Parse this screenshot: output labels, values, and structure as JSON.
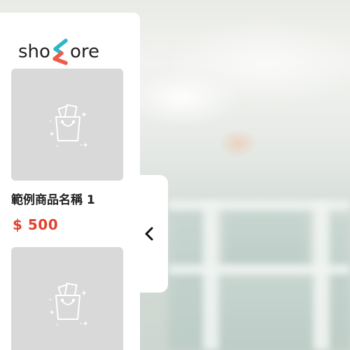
{
  "brand": {
    "logo_prefix": "sho",
    "logo_suffix": "ore",
    "logo_mark_colors": [
      "#2fb6c9",
      "#ef5a4a"
    ]
  },
  "products": [
    {
      "name": "範例商品名稱 1",
      "price": "$ 500",
      "image_icon": "shopping-bag-placeholder-icon"
    },
    {
      "name": "",
      "price": "",
      "image_icon": "shopping-bag-placeholder-icon"
    }
  ],
  "panel": {
    "toggle_icon": "chevron-left-icon"
  },
  "colors": {
    "price": "#e0432f",
    "thumb_bg": "#d9d9d9",
    "panel_bg": "#ffffff"
  }
}
